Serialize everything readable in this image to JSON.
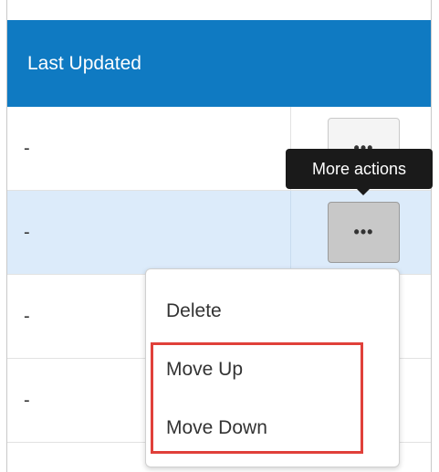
{
  "table": {
    "header": "Last Updated",
    "rows": [
      {
        "last_updated": "-"
      },
      {
        "last_updated": "-"
      },
      {
        "last_updated": "-"
      },
      {
        "last_updated": "-"
      }
    ],
    "action_button_label": "•••"
  },
  "tooltip": {
    "text": "More actions"
  },
  "menu": {
    "items": [
      {
        "label": "Delete"
      },
      {
        "label": "Move Up"
      },
      {
        "label": "Move Down"
      }
    ]
  },
  "colors": {
    "header_bg": "#0f7ac2",
    "selected_row_bg": "#dcebfa",
    "highlight_border": "#e0403a"
  }
}
